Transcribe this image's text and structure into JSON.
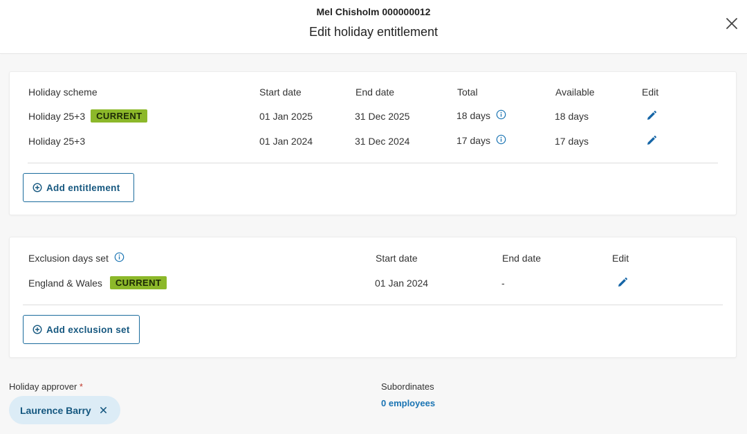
{
  "header": {
    "employee": "Mel Chisholm 000000012",
    "title": "Edit holiday entitlement"
  },
  "entitlements": {
    "columns": {
      "scheme": "Holiday scheme",
      "start": "Start date",
      "end": "End date",
      "total": "Total",
      "available": "Available",
      "edit": "Edit"
    },
    "rows": [
      {
        "scheme": "Holiday 25+3",
        "badge": "CURRENT",
        "start": "01 Jan 2025",
        "end": "31 Dec 2025",
        "total": "18 days",
        "available": "18 days"
      },
      {
        "scheme": "Holiday 25+3",
        "badge": "",
        "start": "01 Jan 2024",
        "end": "31 Dec 2024",
        "total": "17 days",
        "available": "17 days"
      }
    ],
    "add_label": "Add entitlement"
  },
  "exclusions": {
    "columns": {
      "set": "Exclusion days set",
      "start": "Start date",
      "end": "End date",
      "edit": "Edit"
    },
    "rows": [
      {
        "set": "England & Wales",
        "badge": "CURRENT",
        "start": "01 Jan 2024",
        "end": "-"
      }
    ],
    "add_label": "Add exclusion set"
  },
  "approver": {
    "label": "Holiday approver",
    "required_mark": "*",
    "value": "Laurence Barry"
  },
  "subordinates": {
    "label": "Subordinates",
    "value": "0 employees"
  },
  "colors": {
    "badge": "#8cb82a",
    "accent": "#15577f",
    "link": "#1a74b3",
    "chip_bg": "#dcecf6"
  },
  "icons": [
    "close-icon",
    "info-icon",
    "pencil-icon",
    "plus-circle-icon",
    "remove-icon"
  ]
}
